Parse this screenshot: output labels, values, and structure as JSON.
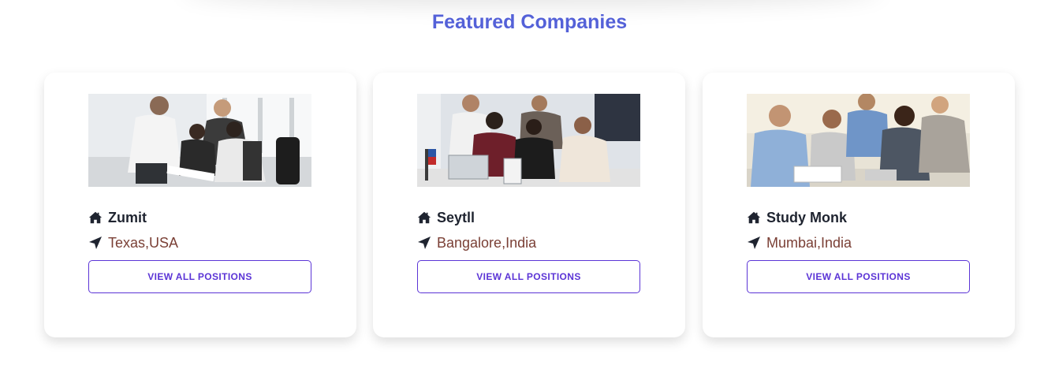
{
  "section": {
    "title": "Featured Companies"
  },
  "companies": [
    {
      "name": "Zumit",
      "location": "Texas,USA",
      "button_label": "VIEW ALL POSITIONS",
      "image_alt": "Team of colleagues reviewing documents at a table"
    },
    {
      "name": "Seytll",
      "location": "Bangalore,India",
      "button_label": "VIEW ALL POSITIONS",
      "image_alt": "Group of young professionals gathered around a laptop"
    },
    {
      "name": "Study Monk",
      "location": "Mumbai,India",
      "button_label": "VIEW ALL POSITIONS",
      "image_alt": "Smiling coworkers collaborating in a bright office"
    }
  ],
  "icons": {
    "company": "home-icon",
    "location": "location-arrow-icon"
  },
  "colors": {
    "accent": "#5461d8",
    "button_border": "#5b34d6",
    "location_text": "#7a3f35",
    "name_text": "#1f2430"
  }
}
